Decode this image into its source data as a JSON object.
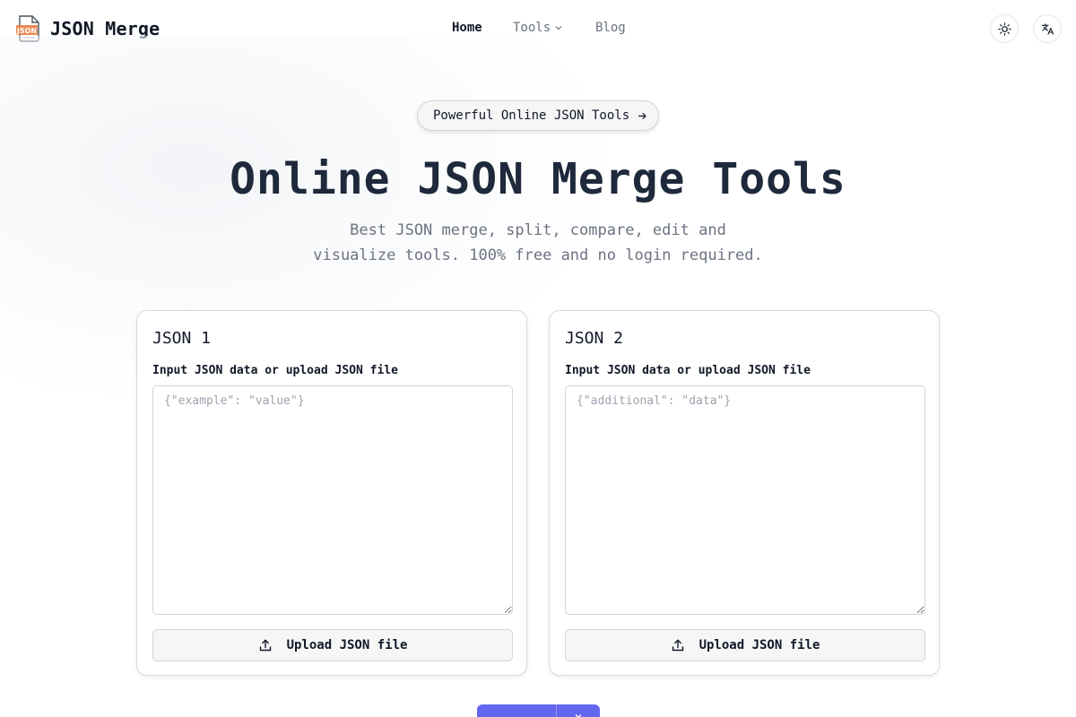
{
  "app": {
    "logo_text": "JSON Merge",
    "logo_icon": "json-file-icon",
    "logo_icon_badge": "JSON"
  },
  "nav": {
    "items": [
      {
        "label": "Home",
        "active": true
      },
      {
        "label": "Tools",
        "active": false,
        "has_dropdown": true
      },
      {
        "label": "Blog",
        "active": false
      }
    ]
  },
  "header_actions": {
    "theme_icon": "sun-icon",
    "language_icon": "translate-icon"
  },
  "hero": {
    "badge_text": "Powerful Online JSON Tools",
    "title": "Online JSON Merge Tools",
    "subtitle_line1": "Best JSON merge, split, compare, edit and",
    "subtitle_line2": "visualize tools. 100% free and no login required."
  },
  "cards": [
    {
      "title": "JSON 1",
      "label": "Input JSON data or upload JSON file",
      "placeholder": "{\"example\": \"value\"}",
      "value": "",
      "upload_label": "Upload JSON file"
    },
    {
      "title": "JSON 2",
      "label": "Input JSON data or upload JSON file",
      "placeholder": "{\"additional\": \"data\"}",
      "value": "",
      "upload_label": "Upload JSON file"
    }
  ],
  "colors": {
    "primary": "#6366f1",
    "text_dark": "#1e293b",
    "text_muted": "#6b7280",
    "logo_accent": "#ea8a54",
    "border": "#d4d4d8"
  }
}
